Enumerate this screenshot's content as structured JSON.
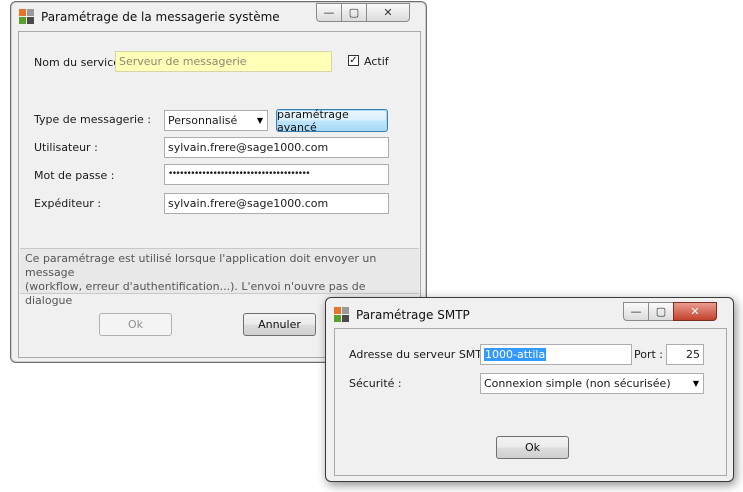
{
  "main_window": {
    "title": "Paramétrage de la messagerie système",
    "controls": {
      "minimize": "—",
      "maximize": "▢",
      "close": "✕"
    },
    "service_name_label": "Nom du service :",
    "service_name_placeholder": "Serveur de messagerie",
    "active_label": "Actif",
    "active_checked": true,
    "active_mark": "✓",
    "mail_type_label": "Type de messagerie :",
    "mail_type_value": "Personnalisé",
    "advanced_button": "paramétrage avancé",
    "user_label": "Utilisateur :",
    "user_value": "sylvain.frere@sage1000.com",
    "password_label": "Mot de passe :",
    "password_mask": "••••••••••••••••••••••••••••••••••••••",
    "sender_label": "Expéditeur :",
    "sender_value": "sylvain.frere@sage1000.com",
    "info_line1": "Ce paramétrage est utilisé lorsque l'application doit envoyer un message",
    "info_line2": "(workflow, erreur d'authentification...). L'envoi n'ouvre pas de dialogue",
    "ok_button": "Ok",
    "cancel_button": "Annuler"
  },
  "smtp_window": {
    "title": "Paramétrage SMTP",
    "controls": {
      "minimize": "—",
      "maximize": "▢",
      "close": "✕"
    },
    "server_label": "Adresse du serveur SMTP :",
    "server_value": "1000-attila",
    "port_label": "Port :",
    "port_value": "25",
    "security_label": "Sécurité :",
    "security_value": "Connexion simple (non sécurisée)",
    "ok_button": "Ok"
  },
  "colors": {
    "icon_orange": "#e8742a",
    "icon_green": "#5aa02c",
    "icon_gray": "#9a9a9a",
    "icon_dark": "#4a4a4a"
  }
}
